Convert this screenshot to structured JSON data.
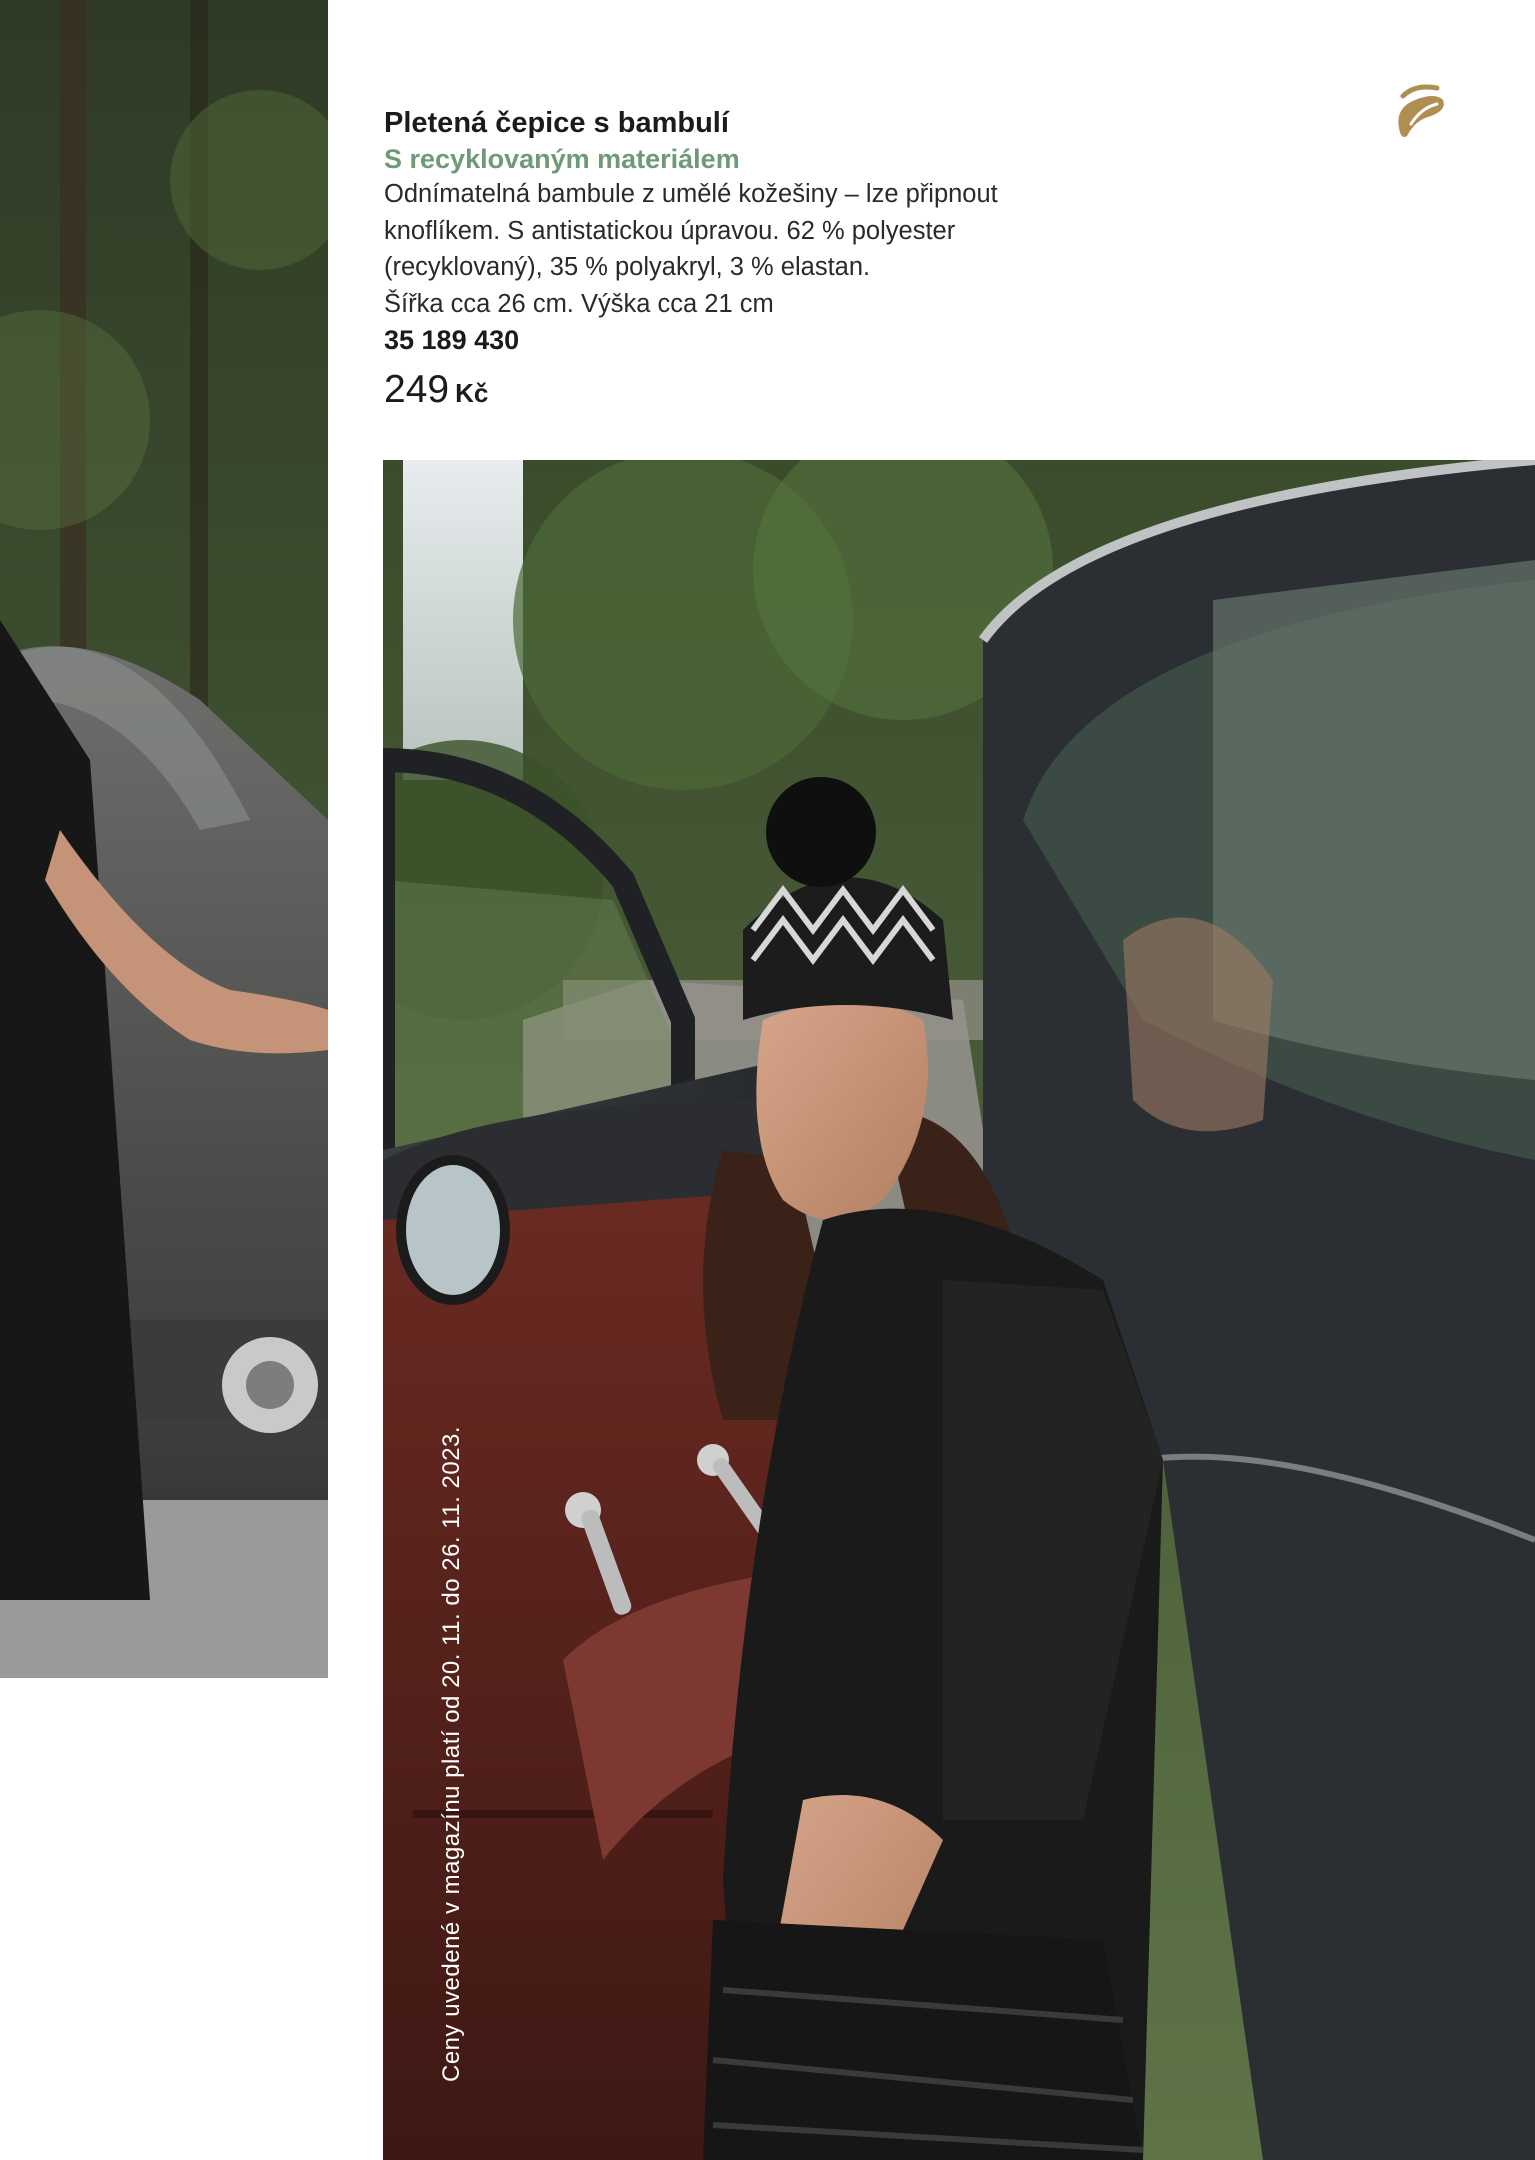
{
  "product": {
    "title": "Pletená čepice s bambulí",
    "subtitle": "S recyklovaným materiálem",
    "description_lines": [
      "Odnímatelná bambule z umělé kožešiny – lze připnout",
      "knoflíkem. S antistatickou úpravou. 62 % polyester",
      "(recyklovaný), 35 % polyakryl, 3 % elastan.",
      "Šířka cca 26 cm. Výška cca 21 cm"
    ],
    "sku": "35 189 430",
    "price_amount": "249",
    "price_currency": "Kč"
  },
  "validity_note": "Ceny uvedené v magazínu platí od 20. 11. do 26. 11. 2023.",
  "brand": {
    "logo_icon": "tchibo-coffee-bean-icon",
    "color": "#b08d50"
  },
  "colors": {
    "subtitle_accent": "#6f9a78"
  }
}
